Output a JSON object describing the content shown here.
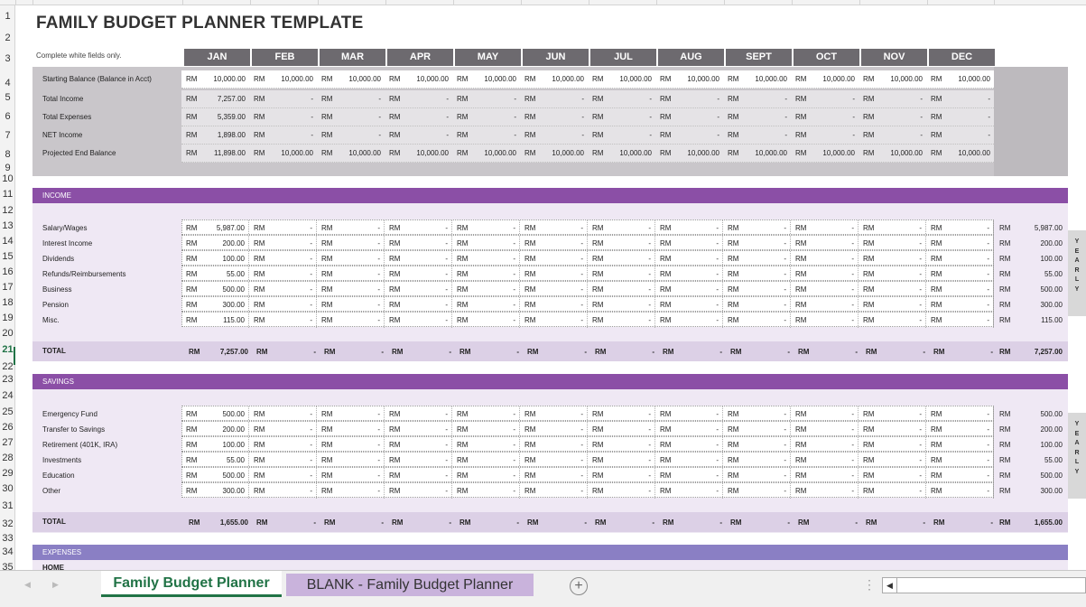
{
  "title": "FAMILY BUDGET PLANNER TEMPLATE",
  "note": "Complete white fields only.",
  "currency": "RM",
  "months": [
    "JAN",
    "FEB",
    "MAR",
    "APR",
    "MAY",
    "JUN",
    "JUL",
    "AUG",
    "SEPT",
    "OCT",
    "NOV",
    "DEC"
  ],
  "summary": [
    {
      "label": "Starting Balance (Balance in Acct)",
      "values": [
        "10,000.00",
        "10,000.00",
        "10,000.00",
        "10,000.00",
        "10,000.00",
        "10,000.00",
        "10,000.00",
        "10,000.00",
        "10,000.00",
        "10,000.00",
        "10,000.00",
        "10,000.00"
      ]
    },
    {
      "label": "Total Income",
      "values": [
        "7,257.00",
        "-",
        "-",
        "-",
        "-",
        "-",
        "-",
        "-",
        "-",
        "-",
        "-",
        "-"
      ]
    },
    {
      "label": "Total Expenses",
      "values": [
        "5,359.00",
        "-",
        "-",
        "-",
        "-",
        "-",
        "-",
        "-",
        "-",
        "-",
        "-",
        "-"
      ]
    },
    {
      "label": "NET Income",
      "values": [
        "1,898.00",
        "-",
        "-",
        "-",
        "-",
        "-",
        "-",
        "-",
        "-",
        "-",
        "-",
        "-"
      ]
    },
    {
      "label": "Projected End Balance",
      "values": [
        "11,898.00",
        "10,000.00",
        "10,000.00",
        "10,000.00",
        "10,000.00",
        "10,000.00",
        "10,000.00",
        "10,000.00",
        "10,000.00",
        "10,000.00",
        "10,000.00",
        "10,000.00"
      ]
    }
  ],
  "yearly_label": "YEARLY",
  "income": {
    "title": "INCOME",
    "rows": [
      {
        "label": "Salary/Wages",
        "jan": "5,987.00",
        "yearly": "5,987.00"
      },
      {
        "label": "Interest Income",
        "jan": "200.00",
        "yearly": "200.00"
      },
      {
        "label": "Dividends",
        "jan": "100.00",
        "yearly": "100.00"
      },
      {
        "label": "Refunds/Reimbursements",
        "jan": "55.00",
        "yearly": "55.00"
      },
      {
        "label": "Business",
        "jan": "500.00",
        "yearly": "500.00"
      },
      {
        "label": "Pension",
        "jan": "300.00",
        "yearly": "300.00"
      },
      {
        "label": "Misc.",
        "jan": "115.00",
        "yearly": "115.00"
      }
    ],
    "total_label": "TOTAL",
    "total_jan": "7,257.00",
    "total_yearly": "7,257.00"
  },
  "savings": {
    "title": "SAVINGS",
    "rows": [
      {
        "label": "Emergency Fund",
        "jan": "500.00",
        "yearly": "500.00"
      },
      {
        "label": "Transfer to Savings",
        "jan": "200.00",
        "yearly": "200.00"
      },
      {
        "label": "Retirement (401K, IRA)",
        "jan": "100.00",
        "yearly": "100.00"
      },
      {
        "label": "Investments",
        "jan": "55.00",
        "yearly": "55.00"
      },
      {
        "label": "Education",
        "jan": "500.00",
        "yearly": "500.00"
      },
      {
        "label": "Other",
        "jan": "300.00",
        "yearly": "300.00"
      }
    ],
    "total_label": "TOTAL",
    "total_jan": "1,655.00",
    "total_yearly": "1,655.00"
  },
  "expenses": {
    "title": "EXPENSES",
    "subhead": "HOME"
  },
  "dash": "-",
  "row_numbers": [
    "1",
    "2",
    "3",
    "4",
    "5",
    "6",
    "7",
    "8",
    "9",
    "10",
    "11",
    "12",
    "13",
    "14",
    "15",
    "16",
    "17",
    "18",
    "19",
    "20",
    "21",
    "22",
    "23",
    "24",
    "25",
    "26",
    "27",
    "28",
    "29",
    "30",
    "31",
    "32",
    "33",
    "34",
    "35"
  ],
  "active_row": "21",
  "tabs": [
    {
      "label": "Family Budget Planner",
      "active": true
    },
    {
      "label": "BLANK - Family Budget Planner",
      "active": false
    }
  ],
  "add_sheet_glyph": "+",
  "more_glyph": "⋮",
  "nav_prev_glyph": "◀",
  "nav_next_glyph": "▶",
  "scroll_left_glyph": "◀",
  "colors": {
    "month_header": "#6d6a6f",
    "income_bar": "#8b4fa6",
    "savings_bar": "#8b4fa6",
    "expenses_bar": "#8a7fc4",
    "section_bg": "#efe8f4",
    "total_bg": "#dcd0e6",
    "active_tab": "#217346",
    "inactive_tab": "#c9b3dc"
  }
}
